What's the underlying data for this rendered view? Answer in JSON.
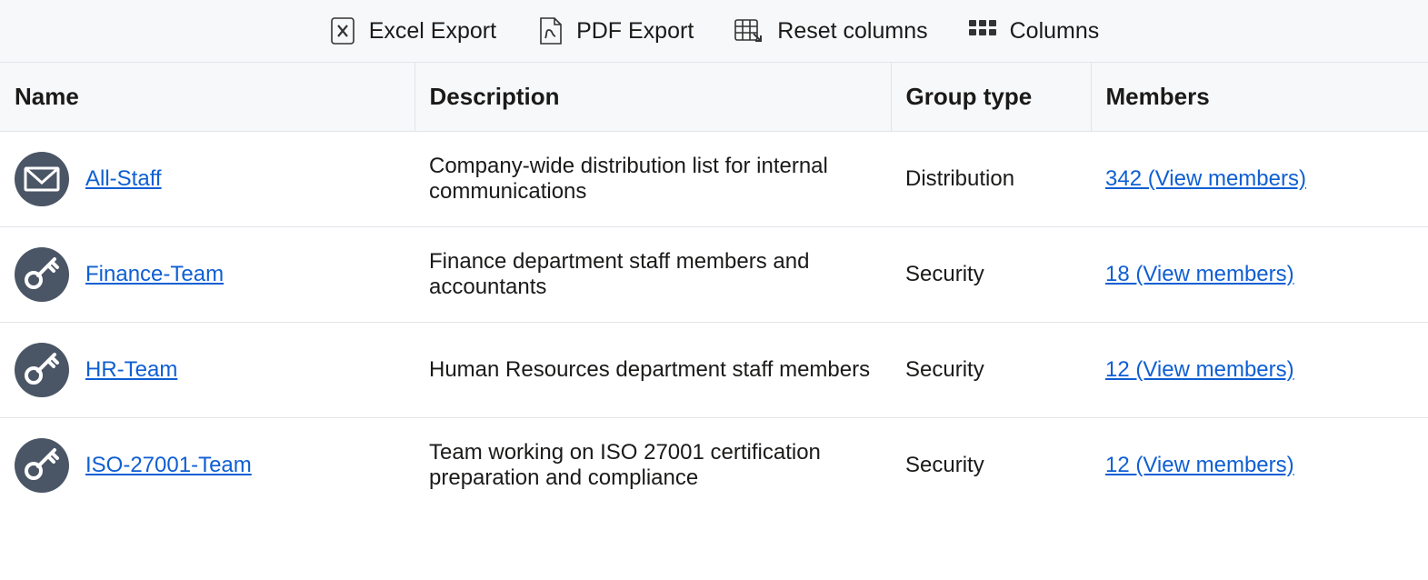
{
  "toolbar": {
    "excel_export": "Excel Export",
    "pdf_export": "PDF Export",
    "reset_columns": "Reset columns",
    "columns": "Columns"
  },
  "columns": {
    "name": "Name",
    "description": "Description",
    "group_type": "Group type",
    "members": "Members"
  },
  "rows": [
    {
      "icon": "envelope",
      "name": "All-Staff",
      "description": "Company-wide distribution list for internal communications",
      "group_type": "Distribution",
      "members_label": "342 (View members)"
    },
    {
      "icon": "key",
      "name": "Finance-Team",
      "description": "Finance department staff members and accountants",
      "group_type": "Security",
      "members_label": "18 (View members)"
    },
    {
      "icon": "key",
      "name": "HR-Team",
      "description": "Human Resources department staff members",
      "group_type": "Security",
      "members_label": "12 (View members)"
    },
    {
      "icon": "key",
      "name": "ISO-27001-Team",
      "description": "Team working on ISO 27001 certification preparation and compliance",
      "group_type": "Security",
      "members_label": "12 (View members)"
    }
  ]
}
